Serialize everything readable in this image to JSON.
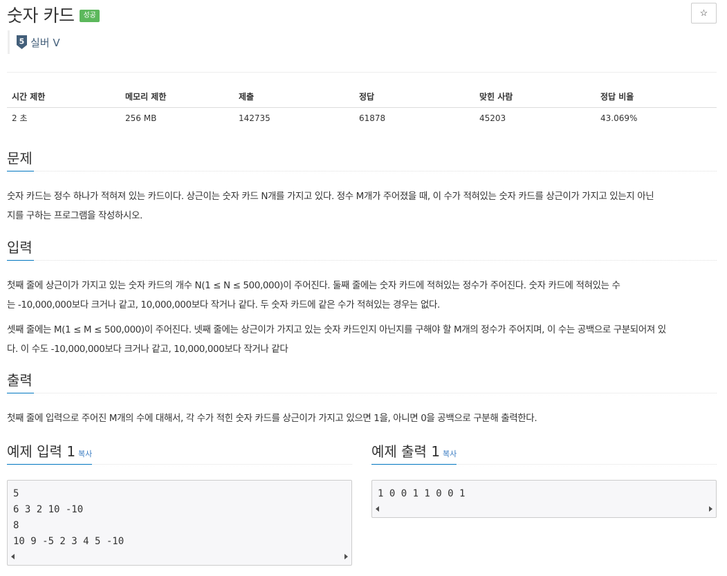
{
  "problem": {
    "title": "숫자 카드",
    "status_badge": "성공",
    "star_icon": "☆",
    "tier": {
      "label": "실버 V",
      "number": "5",
      "color": "#435f7a"
    }
  },
  "info_table": {
    "headers": [
      "시간 제한",
      "메모리 제한",
      "제출",
      "정답",
      "맞힌 사람",
      "정답 비율"
    ],
    "values": [
      "2 초",
      "256 MB",
      "142735",
      "61878",
      "45203",
      "43.069%"
    ]
  },
  "sections": {
    "description": {
      "heading": "문제",
      "lines": [
        "숫자 카드는 정수 하나가 적혀져 있는 카드이다. 상근이는 숫자 카드 N개를 가지고 있다. 정수 M개가 주어졌을 때, 이 수가 적혀있는 숫자 카드를 상근이가 가지고 있는지 아닌",
        "지를 구하는 프로그램을 작성하시오."
      ]
    },
    "input": {
      "heading": "입력",
      "para1_lines": [
        "첫째 줄에 상근이가 가지고 있는 숫자 카드의 개수 N(1 ≤ N ≤ 500,000)이 주어진다. 둘째 줄에는 숫자 카드에 적혀있는 정수가 주어진다. 숫자 카드에 적혀있는 수",
        "는 -10,000,000보다 크거나 같고, 10,000,000보다 작거나 같다. 두 숫자 카드에 같은 수가 적혀있는 경우는 없다."
      ],
      "para2_lines": [
        "셋째 줄에는 M(1 ≤ M ≤ 500,000)이 주어진다. 넷째 줄에는 상근이가 가지고 있는 숫자 카드인지 아닌지를 구해야 할 M개의 정수가 주어지며, 이 수는 공백으로 구분되어져 있",
        "다. 이 수도 -10,000,000보다 크거나 같고, 10,000,000보다 작거나 같다"
      ]
    },
    "output": {
      "heading": "출력",
      "text": "첫째 줄에 입력으로 주어진 M개의 수에 대해서, 각 수가 적힌 숫자 카드를 상근이가 가지고 있으면 1을, 아니면 0을 공백으로 구분해 출력한다."
    }
  },
  "samples": {
    "input": {
      "heading": "예제 입력 1",
      "copy_label": "복사",
      "content": "5\n6 3 2 10 -10\n8\n10 9 -5 2 3 4 5 -10"
    },
    "output": {
      "heading": "예제 출력 1",
      "copy_label": "복사",
      "content": "1 0 0 1 1 0 0 1"
    }
  },
  "colors": {
    "badge": "#5cb85c",
    "accent_underline": "#0076c0",
    "link": "#3a7cc2"
  }
}
